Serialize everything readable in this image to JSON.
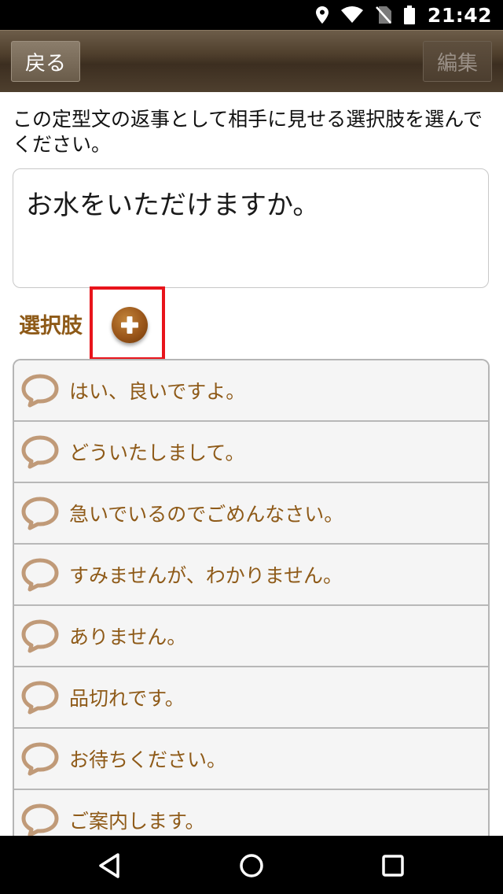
{
  "status_bar": {
    "time": "21:42"
  },
  "toolbar": {
    "back_label": "戻る",
    "edit_label": "編集"
  },
  "instruction": "この定型文の返事として相手に見せる選択肢を選んでください。",
  "phrase": "お水をいただけますか。",
  "choices_label": "選択肢",
  "choices": [
    {
      "label": "はい、良いですよ。"
    },
    {
      "label": "どういたしまして。"
    },
    {
      "label": "急いでいるのでごめんなさい。"
    },
    {
      "label": "すみませんが、わかりません。"
    },
    {
      "label": "ありません。"
    },
    {
      "label": "品切れです。"
    },
    {
      "label": "お待ちください。"
    },
    {
      "label": "ご案内します。"
    }
  ],
  "icons": {
    "location": "location-icon",
    "wifi": "wifi-icon",
    "no_sim": "no-sim-icon",
    "battery": "battery-icon",
    "add": "add-icon",
    "chat": "chat-bubble-icon",
    "nav_back": "back-triangle-icon",
    "nav_home": "home-circle-icon",
    "nav_recents": "recents-square-icon"
  },
  "colors": {
    "accent_brown": "#8e5a18",
    "bubble_tan": "#c09a78",
    "highlight_red": "#e8141b"
  }
}
